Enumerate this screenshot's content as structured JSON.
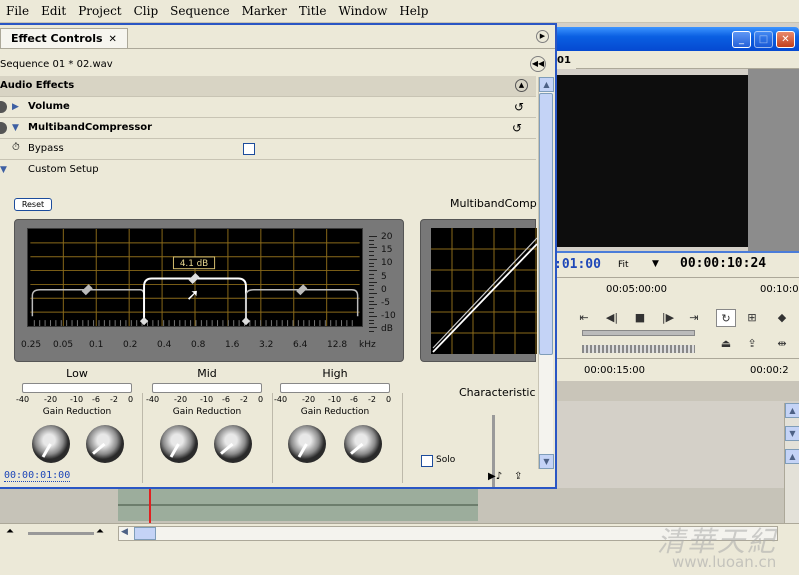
{
  "menu": [
    "File",
    "Edit",
    "Project",
    "Clip",
    "Sequence",
    "Marker",
    "Title",
    "Window",
    "Help"
  ],
  "panel": {
    "tab_label": "Effect Controls",
    "sequence_label": "Sequence 01 * 02.wav",
    "section_title": "Audio Effects",
    "effects": {
      "volume": "Volume",
      "multiband": "MultibandCompressor"
    },
    "bypass_label": "Bypass",
    "custom_setup_label": "Custom Setup",
    "reset_label": "Reset",
    "plugin_title": "MultibandComp",
    "gain_tooltip": "4.1 dB",
    "db_scale": [
      "20",
      "15",
      "10",
      "5",
      "0",
      "-5",
      "-10",
      "dB"
    ],
    "freq_labels": [
      "0.25",
      "0.05",
      "0.1",
      "0.2",
      "0.4",
      "0.8",
      "1.6",
      "3.2",
      "6.4",
      "12.8",
      "kHz"
    ],
    "bands": [
      {
        "name": "Low",
        "gain_label": "Gain Reduction"
      },
      {
        "name": "Mid",
        "gain_label": "Gain Reduction"
      },
      {
        "name": "High",
        "gain_label": "Gain Reduction"
      }
    ],
    "meter_ticks": [
      "-40",
      "-20",
      "-10",
      "-6",
      "-2",
      "0"
    ],
    "characteristic_label": "Characteristic",
    "solo_label": "Solo",
    "timecode": "00:00:01:00"
  },
  "monitor": {
    "tab_label": "01",
    "timecode": ":01:00",
    "fit_label": "Fit",
    "duration": "00:00:10:24",
    "ruler": [
      "00:05:00:00",
      "00:10:0"
    ],
    "timeline_ruler": [
      "00:00:15:00",
      "00:00:2"
    ]
  },
  "watermark": {
    "text": "清華天紀",
    "url": "www.luoan.cn"
  },
  "colors": {
    "accent": "#2a56c4",
    "timecode": "#1e47b8",
    "graph_grid": "#8a6a1a",
    "curve": "#ffffff"
  },
  "eq_curve": {
    "low_level_db": 0,
    "mid_level_db": 4.1,
    "high_level_db": 0
  }
}
